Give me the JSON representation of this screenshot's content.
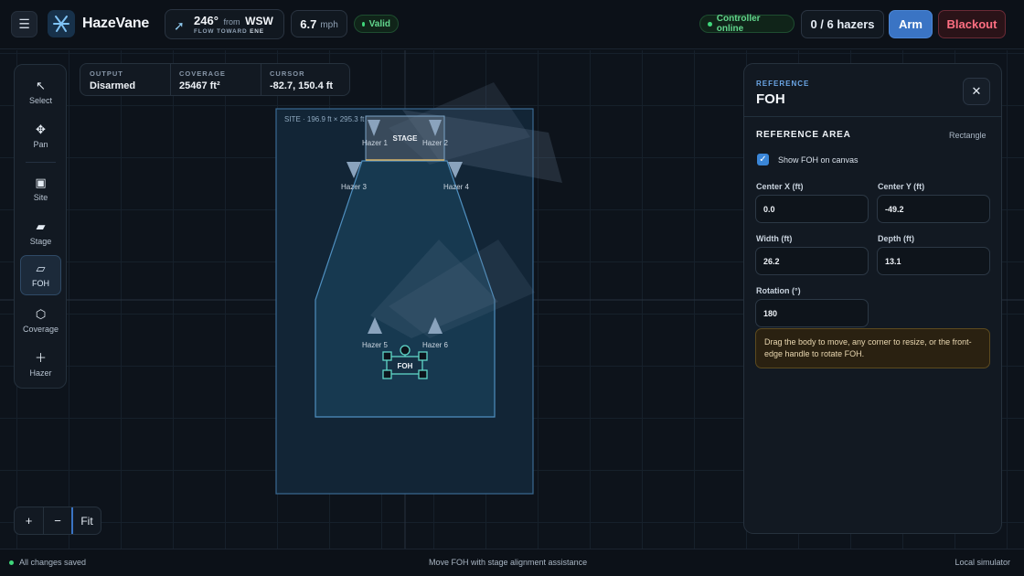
{
  "app": {
    "name": "HazeVane"
  },
  "wind": {
    "direction_deg": "246°",
    "from_label": "from",
    "from_dir": "WSW",
    "flow_label": "FLOW TOWARD",
    "flow_dir": "ENE",
    "speed": "6.7",
    "speed_unit": "mph"
  },
  "status": {
    "validity": "Valid",
    "controller": "Controller online",
    "hazers": "0 / 6 hazers",
    "arm_label": "Arm",
    "blackout_label": "Blackout"
  },
  "tools": [
    {
      "label": "Select",
      "icon": "cursor-arrow-icon"
    },
    {
      "label": "Pan",
      "icon": "move-cross-icon"
    },
    {
      "label": "Site",
      "icon": "square-icon"
    },
    {
      "label": "Stage",
      "icon": "parallelogram-icon"
    },
    {
      "label": "FOH",
      "icon": "parallelogram-outline-icon"
    },
    {
      "label": "Coverage",
      "icon": "hexagon-icon"
    },
    {
      "label": "Hazer",
      "icon": "plus-icon"
    }
  ],
  "stats": {
    "output_label": "OUTPUT",
    "output_value": "Disarmed",
    "coverage_label": "COVERAGE",
    "coverage_value": "25467 ft²",
    "cursor_label": "CURSOR",
    "cursor_value": "-82.7, 150.4 ft"
  },
  "canvas": {
    "site_label": "SITE · 196.9 ft × 295.3 ft",
    "stage_label": "STAGE",
    "foh_label": "FOH",
    "hazers": [
      "Hazer 1",
      "Hazer 2",
      "Hazer 3",
      "Hazer 4",
      "Hazer 5",
      "Hazer 6"
    ]
  },
  "zoom": {
    "zoom_in": "+",
    "zoom_out": "−",
    "fit": "Fit"
  },
  "panel": {
    "kicker": "REFERENCE",
    "title": "FOH",
    "section_title": "REFERENCE AREA",
    "shape": "Rectangle",
    "show_label": "Show FOH on canvas",
    "center_x_label": "Center X (ft)",
    "center_x": "0.0",
    "center_y_label": "Center Y (ft)",
    "center_y": "-49.2",
    "width_label": "Width (ft)",
    "width": "26.2",
    "depth_label": "Depth (ft)",
    "depth": "13.1",
    "rotation_label": "Rotation (°)",
    "rotation": "180",
    "hint": "Drag the body to move, any corner to resize, or the front-edge handle to rotate FOH."
  },
  "statusbar": {
    "left": "All changes saved",
    "center": "Move FOH with stage alignment assistance",
    "right": "Local simulator"
  },
  "colors": {
    "accent": "#3a74c4",
    "success": "#3fd77b",
    "danger": "#ff6f82",
    "site_fill": "#13283a",
    "foh_outline": "#5fd6c8"
  }
}
